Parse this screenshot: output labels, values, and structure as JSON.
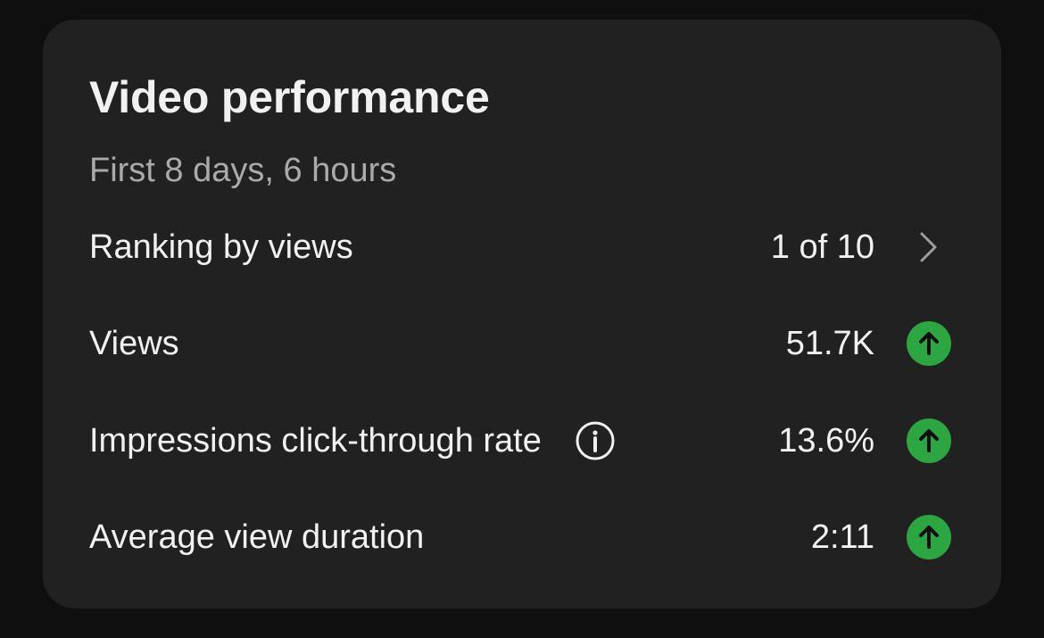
{
  "card": {
    "title": "Video performance",
    "subtitle": "First 8 days, 6 hours"
  },
  "metrics": [
    {
      "label": "Ranking by views",
      "value": "1 of 10",
      "trailing_icon": "chevron-right-icon"
    },
    {
      "label": "Views",
      "value": "51.7K",
      "trailing_icon": "arrow-up-icon"
    },
    {
      "label": "Impressions click-through rate",
      "value": "13.6%",
      "trailing_icon": "arrow-up-icon",
      "info_icon": "info-icon"
    },
    {
      "label": "Average view duration",
      "value": "2:11",
      "trailing_icon": "arrow-up-icon"
    }
  ],
  "colors": {
    "background": "#0f0f0f",
    "card": "#212121",
    "text_primary": "#f1f1f1",
    "text_secondary": "#aaaaaa",
    "trend_up": "#2ba640"
  }
}
